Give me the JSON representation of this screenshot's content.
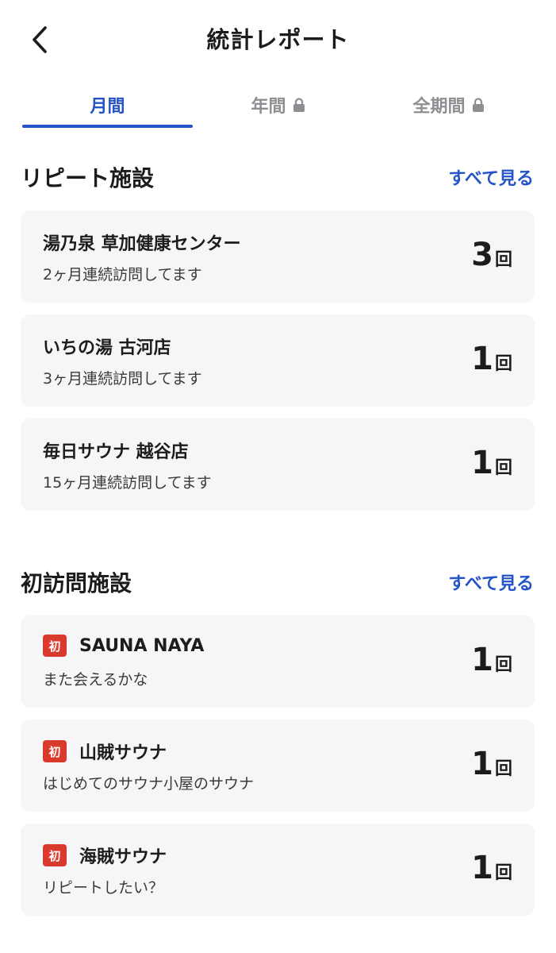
{
  "header": {
    "title": "統計レポート",
    "back_icon": "chevron-left-icon"
  },
  "tabs": [
    {
      "label": "月間",
      "locked": false,
      "active": true
    },
    {
      "label": "年間",
      "locked": true,
      "active": false
    },
    {
      "label": "全期間",
      "locked": true,
      "active": false
    }
  ],
  "colors": {
    "accent": "#2553c8",
    "badge": "#d93a2b",
    "card_bg": "#f6f6f8"
  },
  "repeat": {
    "title": "リピート施設",
    "see_all": "すべて見る",
    "items": [
      {
        "name": "湯乃泉 草加健康センター",
        "note": "2ヶ月連続訪問してます",
        "count": "3",
        "unit": "回"
      },
      {
        "name": "いちの湯 古河店",
        "note": "3ヶ月連続訪問してます",
        "count": "1",
        "unit": "回"
      },
      {
        "name": "毎日サウナ 越谷店",
        "note": "15ヶ月連続訪問してます",
        "count": "1",
        "unit": "回"
      }
    ]
  },
  "first_visit": {
    "title": "初訪問施設",
    "see_all": "すべて見る",
    "badge": "初",
    "items": [
      {
        "name": "SAUNA NAYA",
        "note": "また会えるかな",
        "count": "1",
        "unit": "回"
      },
      {
        "name": "山賊サウナ",
        "note": "はじめてのサウナ小屋のサウナ",
        "count": "1",
        "unit": "回"
      },
      {
        "name": "海賊サウナ",
        "note": "リピートしたい？",
        "count": "1",
        "unit": "回"
      }
    ]
  }
}
